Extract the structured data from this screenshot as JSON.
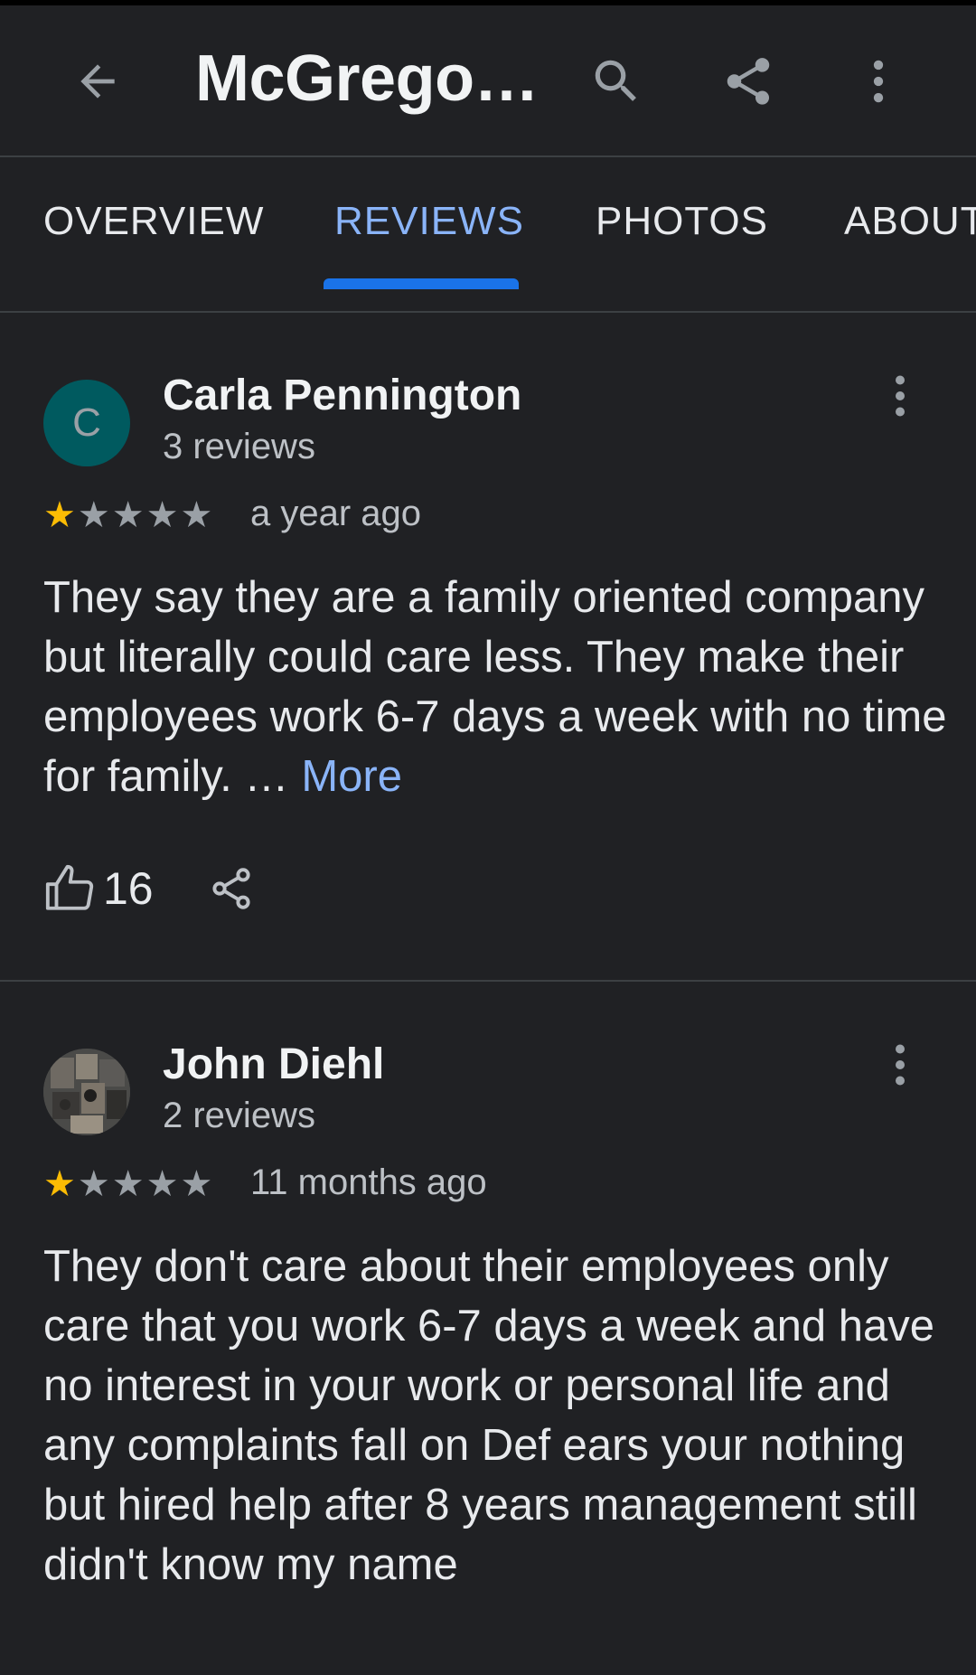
{
  "header": {
    "title": "McGrego…",
    "back_icon": "arrow-left-icon",
    "search_icon": "search-icon",
    "share_icon": "share-icon",
    "more_icon": "more-vert-icon"
  },
  "tabs": [
    {
      "label": "OVERVIEW",
      "active": false
    },
    {
      "label": "REVIEWS",
      "active": true
    },
    {
      "label": "PHOTOS",
      "active": false
    },
    {
      "label": "ABOUT",
      "active": false
    }
  ],
  "colors": {
    "background": "#202124",
    "accent": "#8ab4f8",
    "indicator": "#1a73e8",
    "star_filled": "#fbbc04",
    "star_empty": "#9aa0a6"
  },
  "reviews": [
    {
      "avatar_letter": "C",
      "name": "Carla Pennington",
      "review_count": "3 reviews",
      "rating": 1,
      "time": "a year ago",
      "text": "They say they are a family oriented company but literally could care less. They make their employees work 6-7 days a week with no time for family. …",
      "more_label": "More",
      "likes": "16"
    },
    {
      "avatar_letter": "",
      "name": "John Diehl",
      "review_count": "2 reviews",
      "rating": 1,
      "time": "11 months ago",
      "text": "They don't care about their employees only care that you work 6-7 days a week and have no interest in your work or personal life and any complaints fall on Def ears your nothing but hired help after 8 years management still didn't know my name"
    }
  ]
}
